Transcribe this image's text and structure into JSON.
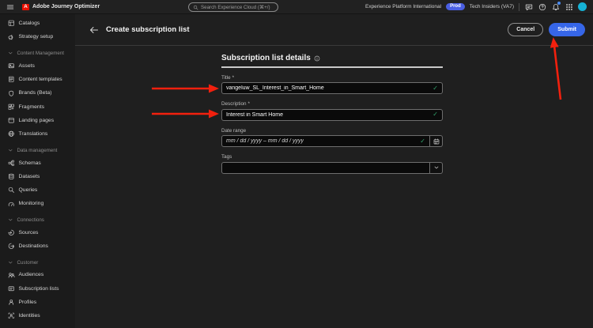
{
  "topbar": {
    "logo_letter": "A",
    "app_title": "Adobe Journey Optimizer",
    "search_placeholder": "Search Experience Cloud (⌘+/)",
    "org_name": "Experience Platform International",
    "env_badge": "Prod",
    "tenant_name": "Tech Insiders (VA7)",
    "icons": [
      "hamburger-icon",
      "adobe-logo",
      "search-icon",
      "feedback-icon",
      "help-icon",
      "bell-icon",
      "app-switcher-icon",
      "avatar"
    ]
  },
  "sidebar": {
    "items": [
      {
        "type": "item",
        "label": "Catalogs",
        "icon": "catalogs-icon"
      },
      {
        "type": "item",
        "label": "Strategy setup",
        "icon": "strategy-setup-icon"
      },
      {
        "type": "section",
        "label": "Content Management",
        "icon": "chevron-down-icon"
      },
      {
        "type": "item",
        "label": "Assets",
        "icon": "assets-icon"
      },
      {
        "type": "item",
        "label": "Content templates",
        "icon": "content-templates-icon"
      },
      {
        "type": "item",
        "label": "Brands (Beta)",
        "icon": "brands-icon"
      },
      {
        "type": "item",
        "label": "Fragments",
        "icon": "fragments-icon"
      },
      {
        "type": "item",
        "label": "Landing pages",
        "icon": "landing-pages-icon"
      },
      {
        "type": "item",
        "label": "Translations",
        "icon": "translations-icon"
      },
      {
        "type": "section",
        "label": "Data management",
        "icon": "chevron-down-icon"
      },
      {
        "type": "item",
        "label": "Schemas",
        "icon": "schemas-icon"
      },
      {
        "type": "item",
        "label": "Datasets",
        "icon": "datasets-icon"
      },
      {
        "type": "item",
        "label": "Queries",
        "icon": "queries-icon"
      },
      {
        "type": "item",
        "label": "Monitoring",
        "icon": "monitoring-icon"
      },
      {
        "type": "section",
        "label": "Connections",
        "icon": "chevron-down-icon"
      },
      {
        "type": "item",
        "label": "Sources",
        "icon": "sources-icon"
      },
      {
        "type": "item",
        "label": "Destinations",
        "icon": "destinations-icon"
      },
      {
        "type": "section",
        "label": "Customer",
        "icon": "chevron-down-icon"
      },
      {
        "type": "item",
        "label": "Audiences",
        "icon": "audiences-icon"
      },
      {
        "type": "item",
        "label": "Subscription lists",
        "icon": "subscription-lists-icon"
      },
      {
        "type": "item",
        "label": "Profiles",
        "icon": "profiles-icon"
      },
      {
        "type": "item",
        "label": "Identities",
        "icon": "identities-icon"
      }
    ]
  },
  "header": {
    "title": "Create subscription list",
    "cancel_label": "Cancel",
    "submit_label": "Submit"
  },
  "form": {
    "section_title": "Subscription list details",
    "required_marker": "*",
    "title_field": {
      "label": "Title",
      "value": "vangeluw_SL_Interest_in_Smart_Home"
    },
    "description_field": {
      "label": "Description",
      "value": "Interest in Smart Home"
    },
    "date_range_field": {
      "label": "Date range",
      "placeholder": "mm / dd / yyyy  –  mm / dd / yyyy"
    },
    "tags_field": {
      "label": "Tags",
      "value": ""
    }
  },
  "icons": {
    "checkmark_glyph": "✓"
  },
  "colors": {
    "accent_blue": "#3666e8",
    "badge_blue": "#4a5fe3",
    "valid_green": "#30a46c",
    "annotation_red": "#f2200e",
    "avatar_teal": "#16b3d6",
    "adobe_red": "#eb1000",
    "notif_blue": "#4b8bf0"
  }
}
